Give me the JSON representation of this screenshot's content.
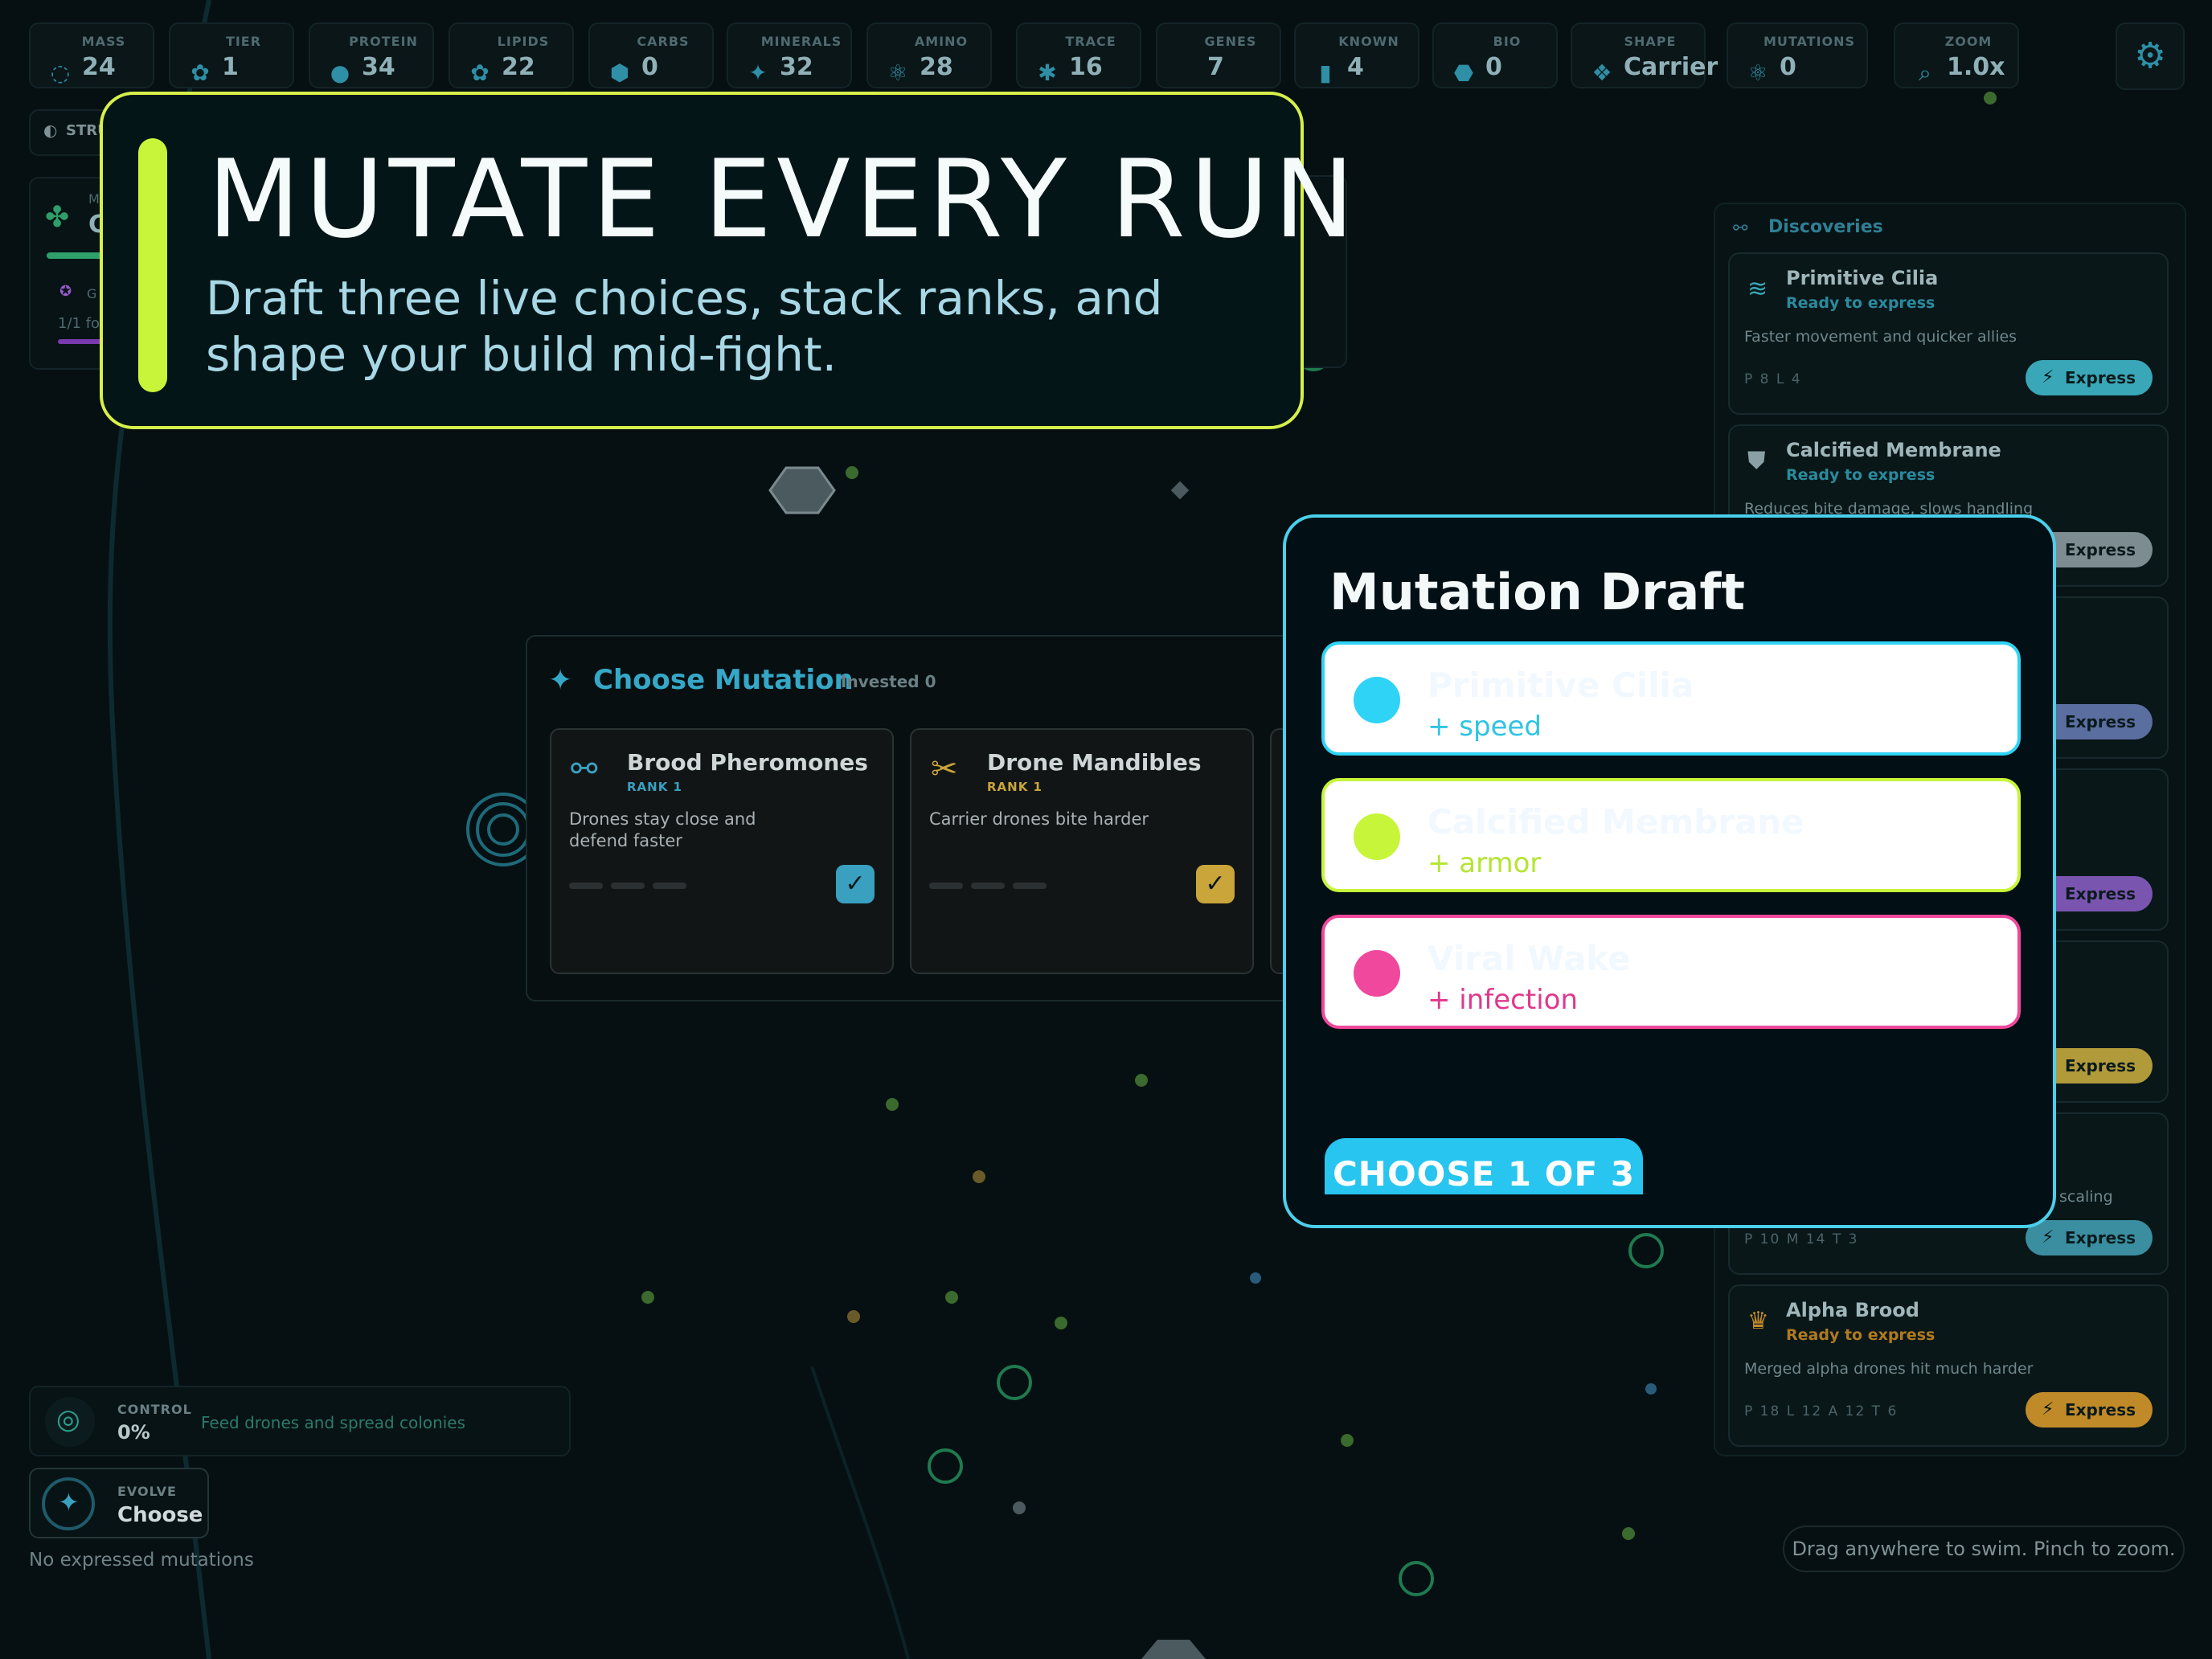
{
  "stats": [
    {
      "label": "MASS",
      "value": "24",
      "icon": "mass-ring-icon"
    },
    {
      "label": "TIER",
      "value": "1",
      "icon": "tier-cluster-icon"
    },
    {
      "label": "PROTEIN",
      "value": "34",
      "icon": "protein-drop-icon"
    },
    {
      "label": "LIPIDS",
      "value": "22",
      "icon": "lipids-cluster-icon"
    },
    {
      "label": "CARBS",
      "value": "0",
      "icon": "carbs-hexagon-icon"
    },
    {
      "label": "MINERALS",
      "value": "32",
      "icon": "minerals-sparkle-icon"
    },
    {
      "label": "AMINO",
      "value": "28",
      "icon": "amino-atom-icon"
    },
    {
      "label": "TRACE",
      "value": "16",
      "icon": "trace-asterisk-icon"
    },
    {
      "label": "GENES",
      "value": "7",
      "icon": "genes-icon"
    },
    {
      "label": "KNOWN",
      "value": "4",
      "icon": "known-book-icon"
    },
    {
      "label": "BIO",
      "value": "0",
      "icon": "bio-blob-icon"
    },
    {
      "label": "SHAPE",
      "value": "Carrier",
      "icon": "shape-diamond-icon"
    },
    {
      "label": "MUTATIONS",
      "value": "0",
      "icon": "mutations-atom-icon"
    },
    {
      "label": "ZOOM",
      "value": "1.0x",
      "icon": "zoom-magnifier-icon"
    }
  ],
  "left": {
    "structure_label": "STRU",
    "mini_card_value": "C",
    "mini_card_label": "M",
    "goal_label": "G",
    "goal_progress": "1/1 fo"
  },
  "hero": {
    "title": "MUTATE EVERY RUN",
    "subtitle": "Draft three live choices, stack ranks, and shape your build mid-fight."
  },
  "discoveries": {
    "title": "Discoveries",
    "express_label": "Express",
    "cards": [
      {
        "name": "Primitive Cilia",
        "status": "Ready to express",
        "desc": "Faster movement and quicker allies",
        "meta": "P 8  L 4",
        "color": "#3aa7b8"
      },
      {
        "name": "Calcified Membrane",
        "status": "Ready to express",
        "desc": "Reduces bite damage, slows handling",
        "meta": "",
        "color": "#7c8c90"
      },
      {
        "name": "",
        "status": "",
        "desc": "",
        "meta": "",
        "color": "#5a6ea0"
      },
      {
        "name": "",
        "status": "",
        "desc": "",
        "meta": "",
        "color": "#7a55b0"
      },
      {
        "name": "",
        "status": "",
        "desc": "",
        "meta": "",
        "color": "#b09a3a"
      },
      {
        "name": "",
        "status": "",
        "desc": "scaling",
        "meta": "P 10  M 14  T 3",
        "color": "#3a8ea0"
      },
      {
        "name": "Alpha Brood",
        "status": "Ready to express",
        "desc": "Merged alpha drones hit much harder",
        "meta": "P 18  L 12  A 12  T 6",
        "color": "#c08a28"
      }
    ]
  },
  "choose": {
    "title": "Choose Mutation",
    "invested": "Invested 0",
    "cards": [
      {
        "name": "Brood Pheromones",
        "rank": "RANK 1",
        "desc": "Drones stay close and defend faster",
        "accent": "#3aa0c0"
      },
      {
        "name": "Drone Mandibles",
        "rank": "RANK 1",
        "desc": "Carrier drones bite harder",
        "accent": "#c9a53a"
      }
    ]
  },
  "draft": {
    "title": "Mutation Draft",
    "options": [
      {
        "name": "Primitive Cilia",
        "effect": "+ speed",
        "color": "#2fd3f5"
      },
      {
        "name": "Calcified Membrane",
        "effect": "+ armor",
        "color": "#c6f53a"
      },
      {
        "name": "Viral Wake",
        "effect": "+ infection",
        "color": "#f0489c"
      }
    ],
    "choose_label": "CHOOSE 1 OF 3"
  },
  "control": {
    "label": "CONTROL",
    "value": "0%",
    "hint": "Feed drones and spread colonies"
  },
  "evolve": {
    "label": "EVOLVE",
    "value": "Choose"
  },
  "no_mutations": "No expressed mutations",
  "drag_hint": "Drag anywhere to swim. Pinch to zoom."
}
